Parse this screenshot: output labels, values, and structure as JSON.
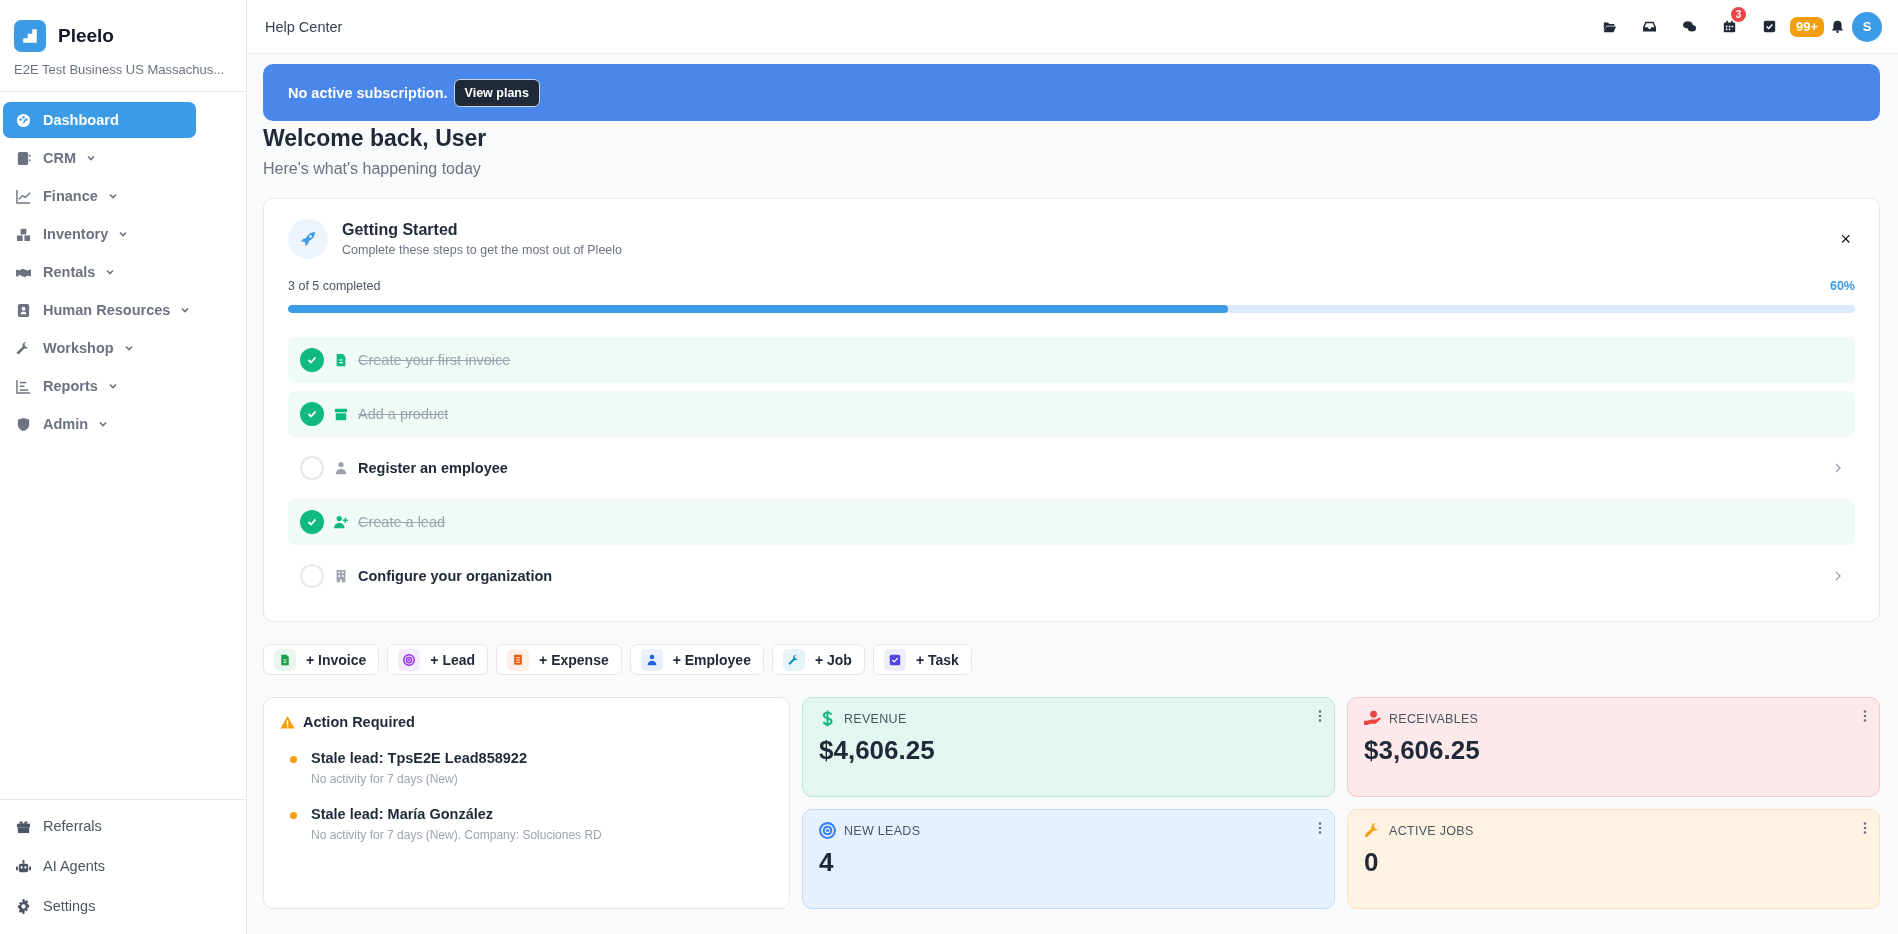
{
  "brand": {
    "name": "Pleelo",
    "business": "E2E Test Business US Massachus..."
  },
  "nav": [
    {
      "label": "Dashboard",
      "selected": true,
      "expandable": false
    },
    {
      "label": "CRM",
      "selected": false,
      "expandable": true
    },
    {
      "label": "Finance",
      "selected": false,
      "expandable": true
    },
    {
      "label": "Inventory",
      "selected": false,
      "expandable": true
    },
    {
      "label": "Rentals",
      "selected": false,
      "expandable": true
    },
    {
      "label": "Human Resources",
      "selected": false,
      "expandable": true
    },
    {
      "label": "Workshop",
      "selected": false,
      "expandable": true
    },
    {
      "label": "Reports",
      "selected": false,
      "expandable": true
    },
    {
      "label": "Admin",
      "selected": false,
      "expandable": true
    }
  ],
  "footer_nav": [
    {
      "label": "Referrals"
    },
    {
      "label": "AI Agents"
    },
    {
      "label": "Settings"
    }
  ],
  "topbar": {
    "title": "Help Center",
    "calendar_badge": "3",
    "notifications_badge": "99+",
    "avatar": "S"
  },
  "banner": {
    "message": "No active subscription.",
    "button": "View plans"
  },
  "welcome": {
    "title": "Welcome back, User",
    "subtitle": "Here's what's happening today"
  },
  "getting_started": {
    "title": "Getting Started",
    "subtitle": "Complete these steps to get the most out of Pleelo",
    "progress_text": "3 of 5 completed",
    "percent": "60%",
    "level": 0.6,
    "close": "×",
    "steps": [
      {
        "label": "Create your first invoice",
        "completed": true
      },
      {
        "label": "Add a product",
        "completed": true
      },
      {
        "label": "Register an employee",
        "completed": false
      },
      {
        "label": "Create a lead",
        "completed": true
      },
      {
        "label": "Configure your organization",
        "completed": false
      }
    ]
  },
  "quick_actions": [
    {
      "label": "+ Invoice",
      "color": "#16a34a"
    },
    {
      "label": "+ Lead",
      "color": "#9333ea"
    },
    {
      "label": "+ Expense",
      "color": "#ea580c"
    },
    {
      "label": "+ Employee",
      "color": "#2563eb"
    },
    {
      "label": "+ Job",
      "color": "#0891b2"
    },
    {
      "label": "+ Task",
      "color": "#4f46e5"
    }
  ],
  "action_required": {
    "title": "Action Required",
    "items": [
      {
        "title": "Stale lead: TpsE2E Lead858922",
        "detail": "No activity for 7 days (New)"
      },
      {
        "title": "Stale lead: María González",
        "detail": "No activity for 7 days (New). Company: Soluciones RD"
      }
    ]
  },
  "stats": [
    {
      "label": "REVENUE",
      "value": "$4,606.25",
      "color": "#10b981"
    },
    {
      "label": "RECEIVABLES",
      "value": "$3,606.25",
      "color": "#ef4444"
    },
    {
      "label": "NEW LEADS",
      "value": "4",
      "color": "#3b82f6"
    },
    {
      "label": "ACTIVE JOBS",
      "value": "0",
      "color": "#f59e0b"
    }
  ]
}
